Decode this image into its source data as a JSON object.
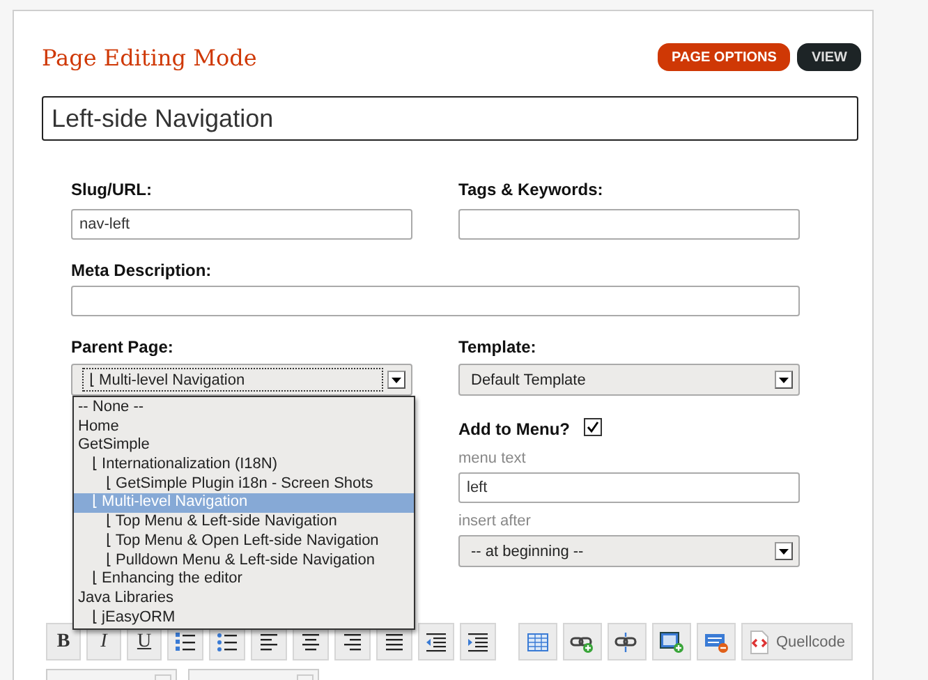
{
  "header": {
    "title": "Page Editing Mode",
    "buttons": [
      {
        "label": "PAGE OPTIONS",
        "kind": "primary"
      },
      {
        "label": "VIEW",
        "kind": "dark"
      }
    ]
  },
  "page_title": {
    "value": "Left-side Navigation"
  },
  "slug": {
    "label": "Slug/URL:",
    "value": "nav-left"
  },
  "tags": {
    "label": "Tags & Keywords:"
  },
  "meta": {
    "label": "Meta Description:"
  },
  "parent": {
    "label": "Parent Page:",
    "value": "⌊ Multi-level Navigation",
    "expanded": true,
    "options": [
      {
        "label": "-- None --",
        "selected": false
      },
      {
        "label": "Home",
        "selected": false
      },
      {
        "label": "GetSimple",
        "selected": false,
        "children": [
          {
            "label": "⌊ Internationalization (I18N)",
            "selected": false,
            "children": [
              {
                "label": "⌊ GetSimple Plugin i18n - Screen Shots",
                "selected": false
              }
            ]
          },
          {
            "label": "⌊ Multi-level Navigation",
            "selected": true,
            "children": [
              {
                "label": "⌊ Top Menu & Left-side Navigation",
                "selected": false
              },
              {
                "label": "⌊ Top Menu & Open Left-side Navigation",
                "selected": false
              },
              {
                "label": "⌊ Pulldown Menu & Left-side Navigation",
                "selected": false
              }
            ]
          },
          {
            "label": "⌊ Enhancing the editor",
            "selected": false
          }
        ]
      },
      {
        "label": "Java Libraries",
        "selected": false,
        "children": [
          {
            "label": "⌊ jEasyORM",
            "selected": false
          }
        ]
      }
    ]
  },
  "template": {
    "label": "Template:",
    "value": "Default Template"
  },
  "menu": {
    "label": "Add to Menu?",
    "checked": true,
    "text_label": "menu text",
    "text_value": "left",
    "after_label": "insert after",
    "after_value": "-- at beginning --"
  },
  "toolbar": {
    "text_buttons": [
      {
        "label": "B",
        "kind": "bold"
      },
      {
        "label": "I",
        "kind": "italic"
      },
      {
        "label": "U",
        "kind": "underline"
      }
    ],
    "source_button": "Quellcode"
  }
}
